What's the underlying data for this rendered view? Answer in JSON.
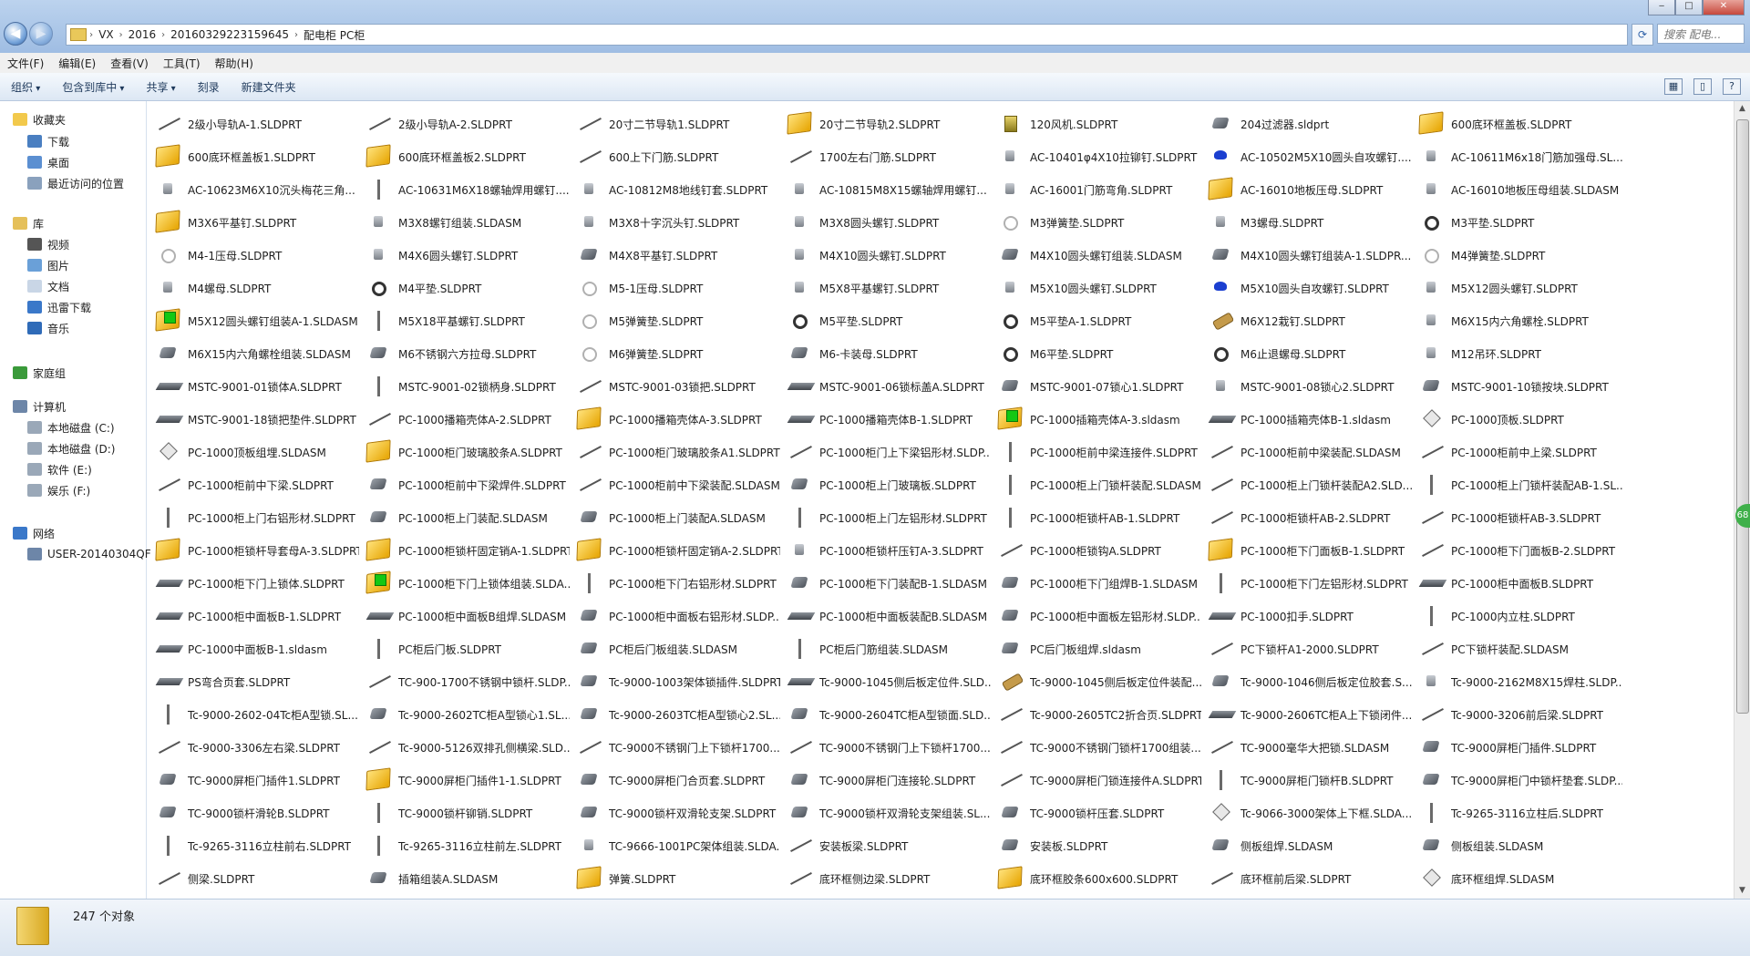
{
  "window": {
    "controls": [
      "‒",
      "□",
      "✕"
    ]
  },
  "address": {
    "crumbs": [
      "VX",
      "2016",
      "20160329223159645",
      "配电柜 PC柜"
    ],
    "search_placeholder": "搜索 配电..."
  },
  "menu": [
    "文件(F)",
    "编辑(E)",
    "查看(V)",
    "工具(T)",
    "帮助(H)"
  ],
  "toolbar": {
    "organize": "组织",
    "include": "包含到库中",
    "share": "共享",
    "burn": "刻录",
    "newfolder": "新建文件夹"
  },
  "sidebar": {
    "favorites": "收藏夹",
    "fav_items": [
      "下载",
      "桌面",
      "最近访问的位置"
    ],
    "libraries": "库",
    "lib_items": [
      "视频",
      "图片",
      "文档",
      "迅雷下载",
      "音乐"
    ],
    "homegroup": "家庭组",
    "computer": "计算机",
    "drives": [
      "本地磁盘 (C:)",
      "本地磁盘 (D:)",
      "软件 (E:)",
      "娱乐 (F:)"
    ],
    "network": "网络",
    "net_items": [
      "USER-20140304QF"
    ]
  },
  "side_badge": "68",
  "status": {
    "count": "247 个对象"
  },
  "files": [
    [
      "2级小导轨A-1.SLDPRT",
      "line"
    ],
    [
      "2级小导轨A-2.SLDPRT",
      "line"
    ],
    [
      "20寸二节导轨1.SLDPRT",
      "line"
    ],
    [
      "20寸二节导轨2.SLDPRT",
      "asm"
    ],
    [
      "120风机.SLDPRT",
      "yellow"
    ],
    [
      "204过滤器.sldprt",
      "part"
    ],
    [
      "600底环框盖板.SLDPRT",
      "asm"
    ],
    [
      "600底环框盖板1.SLDPRT",
      "asm"
    ],
    [
      "600底环框盖板2.SLDPRT",
      "asm"
    ],
    [
      "600上下门筋.SLDPRT",
      "line"
    ],
    [
      "1700左右门筋.SLDPRT",
      "line"
    ],
    [
      "AC-10401φ4X10拉铆钉.SLDPRT",
      "small"
    ],
    [
      "AC-10502M5X10圆头自攻螺钉....",
      "blue"
    ],
    [
      "AC-10611M6x18门筋加强母.SL...",
      "small"
    ],
    [
      "AC-10623M6X10沉头梅花三角...",
      "small"
    ],
    [
      "AC-10631M6X18螺轴焊用螺钉....",
      "vline"
    ],
    [
      "AC-10812M8地线钉套.SLDPRT",
      "small"
    ],
    [
      "AC-10815M8X15螺轴焊用螺钉...",
      "small"
    ],
    [
      "AC-16001门筋弯角.SLDPRT",
      "small"
    ],
    [
      "AC-16010地板压母.SLDPRT",
      "asm"
    ],
    [
      "AC-16010地板压母组装.SLDASM",
      "small"
    ],
    [
      "M3X6平基钉.SLDPRT",
      "asm"
    ],
    [
      "M3X8螺钉组装.SLDASM",
      "small"
    ],
    [
      "M3X8十字沉头钉.SLDPRT",
      "small"
    ],
    [
      "M3X8圆头螺钉.SLDPRT",
      "small"
    ],
    [
      "M3弹簧垫.SLDPRT",
      "ringl"
    ],
    [
      "M3螺母.SLDPRT",
      "small"
    ],
    [
      "M3平垫.SLDPRT",
      "ring"
    ],
    [
      "M4-1压母.SLDPRT",
      "ringl"
    ],
    [
      "M4X6圆头螺钉.SLDPRT",
      "small"
    ],
    [
      "M4X8平基钉.SLDPRT",
      "part"
    ],
    [
      "M4X10圆头螺钉.SLDPRT",
      "small"
    ],
    [
      "M4X10圆头螺钉组装.SLDASM",
      "part"
    ],
    [
      "M4X10圆头螺钉组装A-1.SLDPR...",
      "part"
    ],
    [
      "M4弹簧垫.SLDPRT",
      "ringl"
    ],
    [
      "M4螺母.SLDPRT",
      "small"
    ],
    [
      "M4平垫.SLDPRT",
      "ring"
    ],
    [
      "M5-1压母.SLDPRT",
      "ringl"
    ],
    [
      "M5X8平基螺钉.SLDPRT",
      "small"
    ],
    [
      "M5X10圆头螺钉.SLDPRT",
      "small"
    ],
    [
      "M5X10圆头自攻螺钉.SLDPRT",
      "blue"
    ],
    [
      "M5X12圆头螺钉.SLDPRT",
      "small"
    ],
    [
      "M5X12圆头螺钉组装A-1.SLDASM",
      "asmg"
    ],
    [
      "M5X18平基螺钉.SLDPRT",
      "vline"
    ],
    [
      "M5弹簧垫.SLDPRT",
      "ringl"
    ],
    [
      "M5平垫.SLDPRT",
      "ring"
    ],
    [
      "M5平垫A-1.SLDPRT",
      "ring"
    ],
    [
      "M6X12栽钉.SLDPRT",
      "bar"
    ],
    [
      "M6X15内六角螺栓.SLDPRT",
      "small"
    ],
    [
      "M6X15内六角螺栓组装.SLDASM",
      "part"
    ],
    [
      "M6不锈钢六方拉母.SLDPRT",
      "part"
    ],
    [
      "M6弹簧垫.SLDPRT",
      "ringl"
    ],
    [
      "M6-卡装母.SLDPRT",
      "part"
    ],
    [
      "M6平垫.SLDPRT",
      "ring"
    ],
    [
      "M6止退螺母.SLDPRT",
      "ring"
    ],
    [
      "M12吊环.SLDPRT",
      "small"
    ],
    [
      "MSTC-9001-01锁体A.SLDPRT",
      "flat"
    ],
    [
      "MSTC-9001-02锁柄身.SLDPRT",
      "vline"
    ],
    [
      "MSTC-9001-03锁把.SLDPRT",
      "line"
    ],
    [
      "MSTC-9001-06锁标盖A.SLDPRT",
      "flat"
    ],
    [
      "MSTC-9001-07锁心1.SLDPRT",
      "part"
    ],
    [
      "MSTC-9001-08锁心2.SLDPRT",
      "small"
    ],
    [
      "MSTC-9001-10锁按块.SLDPRT",
      "part"
    ],
    [
      "MSTC-9001-18锁把垫件.SLDPRT",
      "flat"
    ],
    [
      "PC-1000播箱壳体A-2.SLDPRT",
      "line"
    ],
    [
      "PC-1000播箱壳体A-3.SLDPRT",
      "asm"
    ],
    [
      "PC-1000播箱壳体B-1.SLDPRT",
      "flat"
    ],
    [
      "PC-1000插箱壳体A-3.sldasm",
      "asmg"
    ],
    [
      "PC-1000插箱壳体B-1.sldasm",
      "flat"
    ],
    [
      "PC-1000顶板.SLDPRT",
      "diamond"
    ],
    [
      "PC-1000顶板组埋.SLDASM",
      "diamond"
    ],
    [
      "PC-1000柜门玻璃胶条A.SLDPRT",
      "asm"
    ],
    [
      "PC-1000柜门玻璃胶条A1.SLDPRT",
      "line"
    ],
    [
      "PC-1000柜门上下梁铝形材.SLDP...",
      "line"
    ],
    [
      "PC-1000柜前中梁连接件.SLDPRT",
      "vline"
    ],
    [
      "PC-1000柜前中梁装配.SLDASM",
      "line"
    ],
    [
      "PC-1000柜前中上梁.SLDPRT",
      "line"
    ],
    [
      "PC-1000柜前中下梁.SLDPRT",
      "line"
    ],
    [
      "PC-1000柜前中下梁焊件.SLDPRT",
      "part"
    ],
    [
      "PC-1000柜前中下梁装配.SLDASM",
      "line"
    ],
    [
      "PC-1000柜上门玻璃板.SLDPRT",
      "part"
    ],
    [
      "PC-1000柜上门锁杆装配.SLDASM",
      "vline"
    ],
    [
      "PC-1000柜上门锁杆装配A2.SLD...",
      "line"
    ],
    [
      "PC-1000柜上门锁杆装配AB-1.SL...",
      "vline"
    ],
    [
      "PC-1000柜上门右铝形材.SLDPRT",
      "vline"
    ],
    [
      "PC-1000柜上门装配.SLDASM",
      "part"
    ],
    [
      "PC-1000柜上门装配A.SLDASM",
      "part"
    ],
    [
      "PC-1000柜上门左铝形材.SLDPRT",
      "vline"
    ],
    [
      "PC-1000柜锁杆AB-1.SLDPRT",
      "vline"
    ],
    [
      "PC-1000柜锁杆AB-2.SLDPRT",
      "line"
    ],
    [
      "PC-1000柜锁杆AB-3.SLDPRT",
      "line"
    ],
    [
      "PC-1000柜锁杆导套母A-3.SLDPRT",
      "asm"
    ],
    [
      "PC-1000柜锁杆固定销A-1.SLDPRT",
      "asm"
    ],
    [
      "PC-1000柜锁杆固定销A-2.SLDPRT",
      "asm"
    ],
    [
      "PC-1000柜锁杆压钉A-3.SLDPRT",
      "small"
    ],
    [
      "PC-1000柜锁钩A.SLDPRT",
      "line"
    ],
    [
      "PC-1000柜下门面板B-1.SLDPRT",
      "asm"
    ],
    [
      "PC-1000柜下门面板B-2.SLDPRT",
      "line"
    ],
    [
      "PC-1000柜下门上锁体.SLDPRT",
      "flat"
    ],
    [
      "PC-1000柜下门上锁体组装.SLDA...",
      "asmg"
    ],
    [
      "PC-1000柜下门右铝形材.SLDPRT",
      "vline"
    ],
    [
      "PC-1000柜下门装配B-1.SLDASM",
      "part"
    ],
    [
      "PC-1000柜下门组焊B-1.SLDASM",
      "part"
    ],
    [
      "PC-1000柜下门左铝形材.SLDPRT",
      "vline"
    ],
    [
      "PC-1000柜中面板B.SLDPRT",
      "flat"
    ],
    [
      "PC-1000柜中面板B-1.SLDPRT",
      "flat"
    ],
    [
      "PC-1000柜中面板B组焊.SLDASM",
      "flat"
    ],
    [
      "PC-1000柜中面板右铝形材.SLDP...",
      "part"
    ],
    [
      "PC-1000柜中面板装配B.SLDASM",
      "flat"
    ],
    [
      "PC-1000柜中面板左铝形材.SLDP...",
      "part"
    ],
    [
      "PC-1000扣手.SLDPRT",
      "flat"
    ],
    [
      "PC-1000内立柱.SLDPRT",
      "vline"
    ],
    [
      "PC-1000中面板B-1.sldasm",
      "flat"
    ],
    [
      "PC柜后门板.SLDPRT",
      "vline"
    ],
    [
      "PC柜后门板组装.SLDASM",
      "part"
    ],
    [
      "PC柜后门筋组装.SLDASM",
      "vline"
    ],
    [
      "PC后门板组焊.sldasm",
      "part"
    ],
    [
      "PC下锁杆A1-2000.SLDPRT",
      "line"
    ],
    [
      "PC下锁杆装配.SLDASM",
      "line"
    ],
    [
      "PS弯合页套.SLDPRT",
      "flat"
    ],
    [
      "TC-900-1700不锈钢中锁杆.SLDP...",
      "line"
    ],
    [
      "Tc-9000-1003架体锁插件.SLDPRT",
      "part"
    ],
    [
      "Tc-9000-1045侧后板定位件.SLD...",
      "flat"
    ],
    [
      "Tc-9000-1045侧后板定位件装配...",
      "bar"
    ],
    [
      "Tc-9000-1046侧后板定位胶套.S...",
      "part"
    ],
    [
      "Tc-9000-2162M8X15焊柱.SLDP...",
      "small"
    ],
    [
      "Tc-9000-2602-04Tc柜A型锁.SL...",
      "vline"
    ],
    [
      "Tc-9000-2602TC柜A型锁心1.SL...",
      "part"
    ],
    [
      "Tc-9000-2603TC柜A型锁心2.SL...",
      "part"
    ],
    [
      "Tc-9000-2604TC柜A型锁面.SLD...",
      "part"
    ],
    [
      "Tc-9000-2605TC2折合页.SLDPRT",
      "line"
    ],
    [
      "Tc-9000-2606TC柜A上下锁闭件...",
      "flat"
    ],
    [
      "Tc-9000-3206前后梁.SLDPRT",
      "line"
    ],
    [
      "Tc-9000-3306左右梁.SLDPRT",
      "line"
    ],
    [
      "Tc-9000-5126双排孔侧横梁.SLD...",
      "line"
    ],
    [
      "TC-9000不锈钢门上下锁杆1700....",
      "line"
    ],
    [
      "TC-9000不锈钢门上下锁杆1700...",
      "line"
    ],
    [
      "TC-9000不锈钢门锁杆1700组装...",
      "line"
    ],
    [
      "TC-9000毫华大把锁.SLDASM",
      "line"
    ],
    [
      "TC-9000屏柜门插件.SLDPRT",
      "part"
    ],
    [
      "TC-9000屏柜门插件1.SLDPRT",
      "part"
    ],
    [
      "TC-9000屏柜门插件1-1.SLDPRT",
      "asm"
    ],
    [
      "TC-9000屏柜门合页套.SLDPRT",
      "part"
    ],
    [
      "TC-9000屏柜门连接轮.SLDPRT",
      "part"
    ],
    [
      "TC-9000屏柜门锁连接件A.SLDPRT",
      "line"
    ],
    [
      "TC-9000屏柜门锁杆B.SLDPRT",
      "vline"
    ],
    [
      "TC-9000屏柜门中锁杆垫套.SLDP...",
      "part"
    ],
    [
      "TC-9000锁杆滑轮B.SLDPRT",
      "part"
    ],
    [
      "TC-9000锁杆铆销.SLDPRT",
      "vline"
    ],
    [
      "TC-9000锁杆双滑轮支架.SLDPRT",
      "part"
    ],
    [
      "TC-9000锁杆双滑轮支架组装.SL...",
      "part"
    ],
    [
      "TC-9000锁杆压套.SLDPRT",
      "part"
    ],
    [
      "Tc-9066-3000架体上下框.SLDA...",
      "diamond"
    ],
    [
      "Tc-9265-3116立柱后.SLDPRT",
      "vline"
    ],
    [
      "Tc-9265-3116立柱前右.SLDPRT",
      "vline"
    ],
    [
      "Tc-9265-3116立柱前左.SLDPRT",
      "vline"
    ],
    [
      "TC-9666-1001PC架体组装.SLDA...",
      "small"
    ],
    [
      "安装板梁.SLDPRT",
      "line"
    ],
    [
      "安装板.SLDPRT",
      "part"
    ],
    [
      "侧板组焊.SLDASM",
      "part"
    ],
    [
      "侧板组装.SLDASM",
      "part"
    ],
    [
      "侧梁.SLDPRT",
      "line"
    ],
    [
      "插箱组装A.SLDASM",
      "part"
    ],
    [
      "弹簧.SLDPRT",
      "asm"
    ],
    [
      "底环框侧边梁.SLDPRT",
      "line"
    ],
    [
      "底环框胶条600x600.SLDPRT",
      "asm"
    ],
    [
      "底环框前后梁.SLDPRT",
      "line"
    ],
    [
      "底环框组焊.SLDASM",
      "diamond"
    ]
  ]
}
